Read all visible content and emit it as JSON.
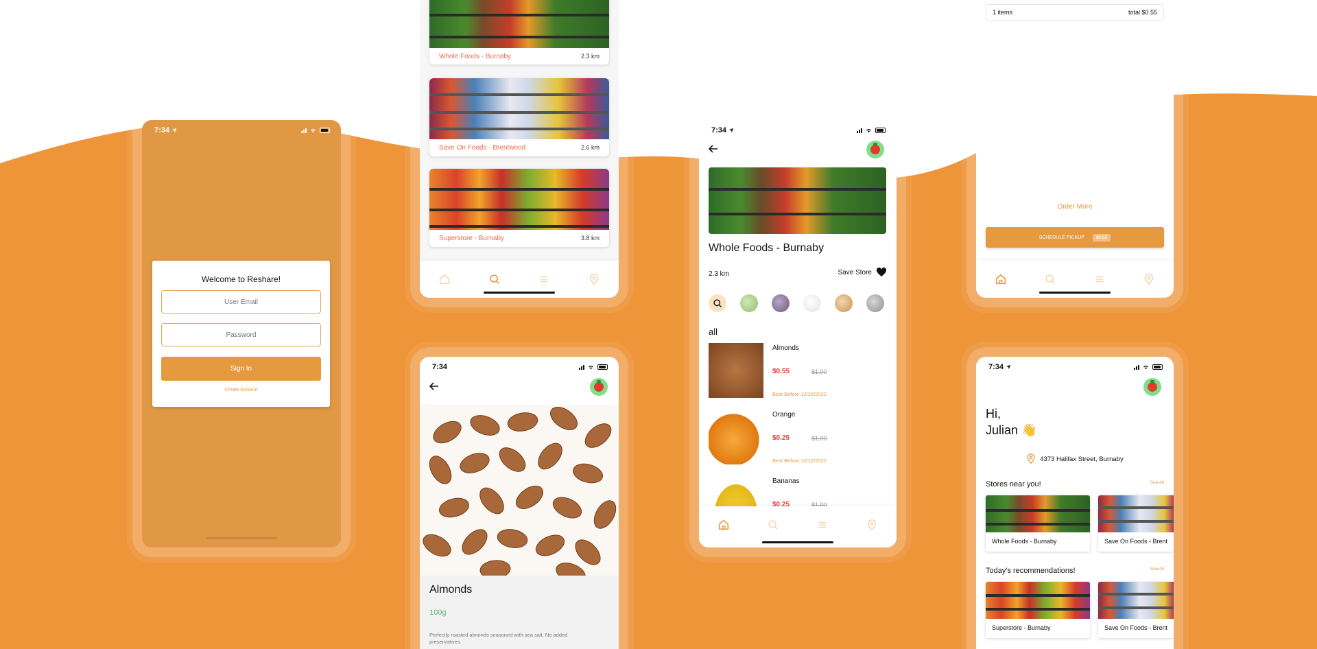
{
  "status": {
    "time": "7:34"
  },
  "login": {
    "title": "Welcome to Reshare!",
    "email_placeholder": "User Email",
    "password_placeholder": "Password",
    "sign_in": "Sign In",
    "create_account": "Create Account"
  },
  "store_list": {
    "stores": [
      {
        "name": "Whole Foods - Burnaby",
        "distance": "2.3 km"
      },
      {
        "name": "Save On Foods - Brentwood",
        "distance": "2.6 km"
      },
      {
        "name": "Superstore - Burnaby",
        "distance": "3.8 km"
      }
    ]
  },
  "product_detail": {
    "name": "Almonds",
    "weight": "100g",
    "description": "Perfectly roasted almonds seasoned with sea salt. No added preservatives."
  },
  "store_detail": {
    "name": "Whole Foods - Burnaby",
    "distance": "2.3 km",
    "save_store": "Save Store",
    "section": "all",
    "products": [
      {
        "name": "Almonds",
        "price": "$0.55",
        "original": "$1.00",
        "best_before": "Best Before 12/25/2022"
      },
      {
        "name": "Orange",
        "price": "$0.25",
        "original": "$1.00",
        "best_before": "Best Before 12/12/2022"
      },
      {
        "name": "Bananas",
        "price": "$0.25",
        "original": "$1.00",
        "best_before": ""
      }
    ]
  },
  "cart": {
    "items": "1 items",
    "total": "total $0.55",
    "order_more": "Order More",
    "schedule_pickup": "SCHEDULE PICKUP",
    "pickup_price": "$0.55"
  },
  "home": {
    "greeting_1": "Hi,",
    "greeting_2": "Julian 👋",
    "address": "4373 Halifax Street, Burnaby",
    "stores_near": "Stores near you!",
    "see_all": "See All",
    "recommendations": "Today's recommendations!",
    "near_cards": [
      "Whole Foods - Burnaby",
      "Save On Foods - Brent"
    ],
    "rec_cards": [
      "Superstore - Burnaby",
      "Save On Foods - Brent"
    ]
  },
  "colors": {
    "accent": "#e69a3f",
    "background_orange": "#ee9439",
    "price_red": "#e53935",
    "green": "#5fb36b"
  }
}
